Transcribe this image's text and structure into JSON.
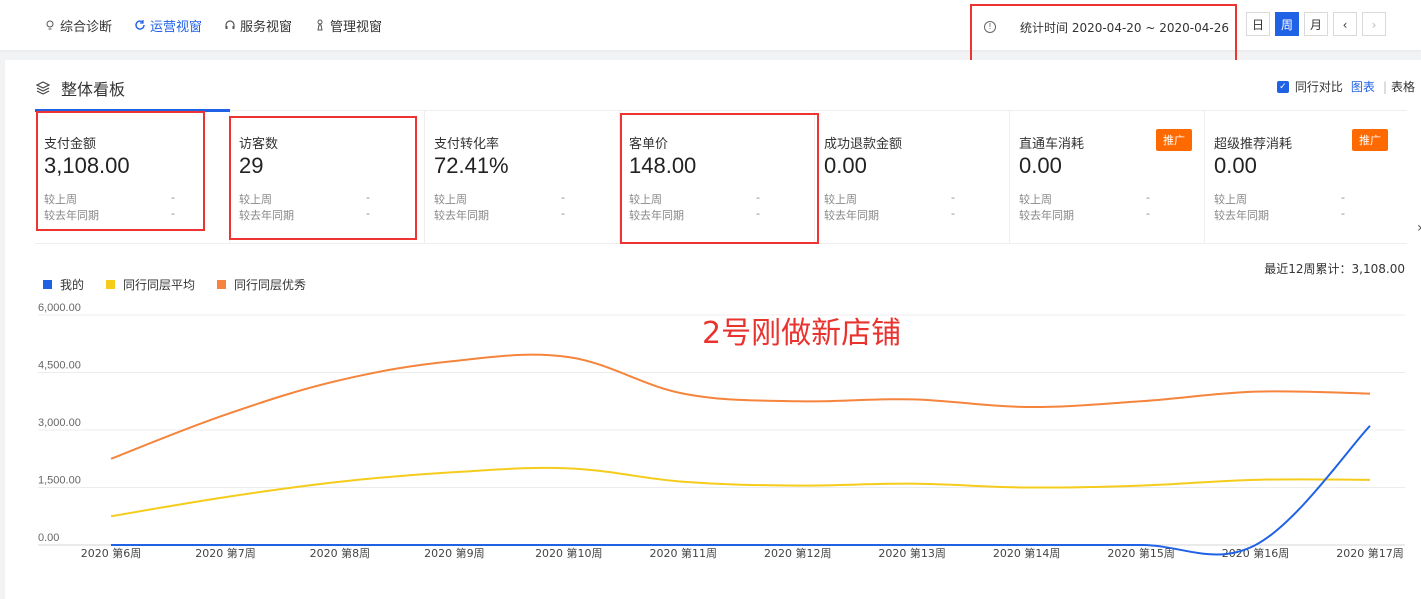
{
  "nav": {
    "tabs": [
      {
        "label": "综合诊断",
        "icon": "bulb-icon"
      },
      {
        "label": "运营视窗",
        "icon": "refresh-icon",
        "active": true
      },
      {
        "label": "服务视窗",
        "icon": "headset-icon"
      },
      {
        "label": "管理视窗",
        "icon": "pawn-icon"
      }
    ]
  },
  "stat": {
    "text": "统计时间 2020-04-20 ~ 2020-04-26"
  },
  "period": {
    "day": "日",
    "week": "周",
    "month": "月",
    "prev": "‹",
    "next": "›"
  },
  "panel": {
    "title": "整体看板",
    "compare_label": "同行对比",
    "view_chart": "图表",
    "separator": "|",
    "view_table": "表格"
  },
  "cards": [
    {
      "label": "支付金额",
      "value": "3,108.00"
    },
    {
      "label": "访客数",
      "value": "29"
    },
    {
      "label": "支付转化率",
      "value": "72.41%"
    },
    {
      "label": "客单价",
      "value": "148.00"
    },
    {
      "label": "成功退款金额",
      "value": "0.00"
    },
    {
      "label": "直通车消耗",
      "value": "0.00",
      "promo": "推广"
    },
    {
      "label": "超级推荐消耗",
      "value": "0.00",
      "promo": "推广"
    }
  ],
  "compare": {
    "last_week": "较上周",
    "last_year": "较去年同期",
    "dash": "-"
  },
  "cumulative": "最近12周累计：3,108.00",
  "annotation": "2号刚做新店铺",
  "colors": {
    "mine": "#2062e6",
    "avg": "#f5cc1b",
    "excellent": "#f5843c",
    "accent": "#2062e6",
    "red": "#e33"
  },
  "chart_data": {
    "type": "line",
    "categories": [
      "2020 第6周",
      "2020 第7周",
      "2020 第8周",
      "2020 第9周",
      "2020 第10周",
      "2020 第11周",
      "2020 第12周",
      "2020 第13周",
      "2020 第14周",
      "2020 第15周",
      "2020 第16周",
      "2020 第17周"
    ],
    "series": [
      {
        "name": "我的",
        "color": "#2062e6",
        "values": [
          0,
          0,
          0,
          0,
          0,
          0,
          0,
          0,
          0,
          0,
          0,
          3108
        ]
      },
      {
        "name": "同行同层平均",
        "color": "#f5cc1b",
        "values": [
          750,
          1250,
          1650,
          1900,
          2000,
          1650,
          1550,
          1600,
          1500,
          1550,
          1700,
          1700
        ]
      },
      {
        "name": "同行同层优秀",
        "color": "#f5843c",
        "values": [
          2250,
          3400,
          4300,
          4800,
          4900,
          3950,
          3750,
          3800,
          3600,
          3750,
          4000,
          3950
        ]
      }
    ],
    "yticks": [
      "0.00",
      "1,500.00",
      "3,000.00",
      "4,500.00",
      "6,000.00"
    ],
    "ylim": [
      0,
      6000
    ]
  }
}
